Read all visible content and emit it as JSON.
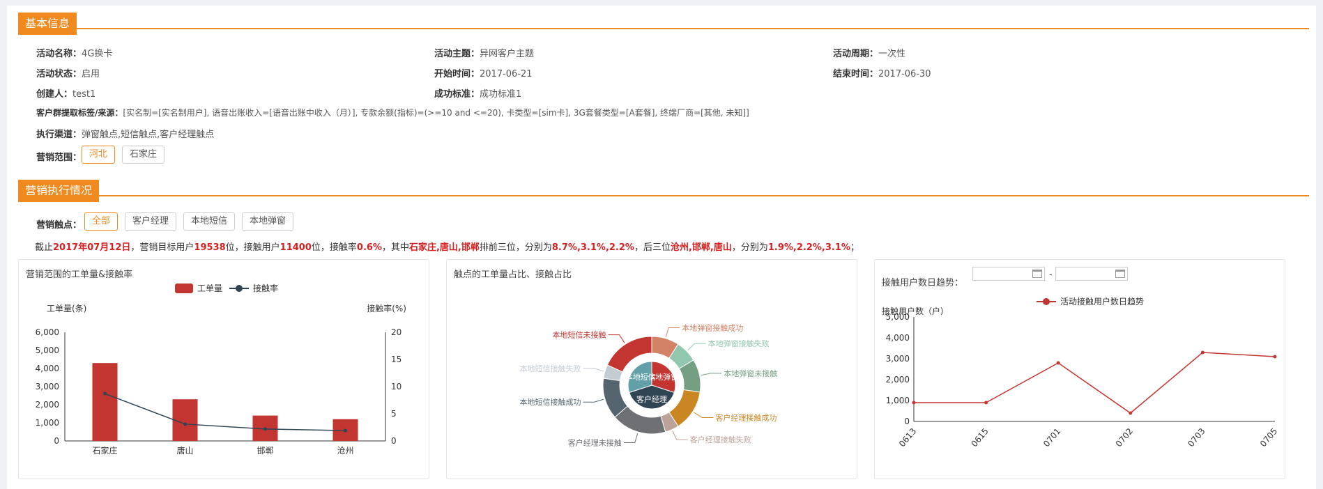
{
  "basic": {
    "title": "基本信息",
    "rows": [
      {
        "label": "活动名称：",
        "value": "4G换卡"
      },
      {
        "label": "活动主题：",
        "value": "异网客户主题"
      },
      {
        "label": "活动周期：",
        "value": "一次性"
      },
      {
        "label": "活动状态：",
        "value": "启用"
      },
      {
        "label": "开始时间：",
        "value": "2017-06-21"
      },
      {
        "label": "结束时间：",
        "value": "2017-06-30"
      },
      {
        "label": "创建人：",
        "value": "test1"
      },
      {
        "label": "成功标准：",
        "value": "成功标准1"
      },
      {
        "label": "客户群提取标签/来源：",
        "value": "[实名制=[实名制用户], 语音出账收入=[语音出账中收入（月）], 专款余额(指标)=(>=10 and <=20), 卡类型=[sim卡], 3G套餐类型=[A套餐], 终端厂商=[其他, 未知]]"
      },
      {
        "label": "执行渠道：",
        "value": "弹窗触点,短信触点,客户经理触点"
      }
    ],
    "scope_label": "营销范围：",
    "scope_chips": [
      "河北",
      "石家庄"
    ]
  },
  "execution": {
    "title": "营销执行情况",
    "touch_label": "营销触点：",
    "touch_chips": [
      "全部",
      "客户经理",
      "本地短信",
      "本地弹窗"
    ],
    "summary": [
      "截止",
      "2017年07月12日",
      "，营销目标用户",
      "19538",
      "位，接触用户",
      "11400",
      "位，接触率",
      "0.6%",
      "，其中",
      "石家庄,唐山,邯郸",
      "排前三位，分别为",
      "8.7%,3.1%,2.2%",
      "，后三位",
      "沧州,邯郸,唐山",
      "，分别为",
      "1.9%,2.2%,3.1%",
      "；"
    ]
  },
  "panel1": {
    "title": "营销范围的工单量&接触率"
  },
  "panel2": {
    "title": "触点的工单量占比、接触占比"
  },
  "panel3": {
    "title": "接触用户数日趋势：",
    "date_separator": "-"
  },
  "colors": {
    "accent": "#f08a1e",
    "bar": "#c23531",
    "line": "#2f4554",
    "highlight": "#d42020"
  },
  "chart_data": [
    {
      "type": "bar",
      "categories": [
        "石家庄",
        "唐山",
        "邯郸",
        "沧州"
      ],
      "series": [
        {
          "name": "工单量",
          "type": "bar",
          "axis": "left",
          "values": [
            4300,
            2300,
            1400,
            1200
          ]
        },
        {
          "name": "接触率",
          "type": "line",
          "axis": "right",
          "values": [
            8.7,
            3.1,
            2.2,
            1.9
          ]
        }
      ],
      "ylabel": "工单量(条)",
      "ylim": [
        0,
        6000
      ],
      "yticks": [
        "0",
        "1,000",
        "2,000",
        "3,000",
        "4,000",
        "5,000",
        "6,000"
      ],
      "y2label": "接触率(%)",
      "y2lim": [
        0,
        20
      ],
      "y2ticks": [
        "0",
        "5",
        "10",
        "15",
        "20"
      ],
      "legend": "top-center"
    },
    {
      "type": "pie",
      "inner": [
        {
          "label": "本地弹窗",
          "value": 30,
          "color": "#c23531"
        },
        {
          "label": "客户经理",
          "value": 40,
          "color": "#2f4554"
        },
        {
          "label": "本地短信",
          "value": 30,
          "color": "#61a0a8"
        }
      ],
      "outer": [
        {
          "label": "本地弹窗接触成功",
          "value": 10,
          "color": "#d48265"
        },
        {
          "label": "本地弹窗接触失败",
          "value": 8,
          "color": "#91c7ae"
        },
        {
          "label": "本地弹窗未接触",
          "value": 12,
          "color": "#749f83"
        },
        {
          "label": "客户经理接触成功",
          "value": 15,
          "color": "#ca8622"
        },
        {
          "label": "客户经理接触失败",
          "value": 5,
          "color": "#bda29a"
        },
        {
          "label": "客户经理未接触",
          "value": 20,
          "color": "#6e7074"
        },
        {
          "label": "本地短信接触成功",
          "value": 15,
          "color": "#546570"
        },
        {
          "label": "本地短信接触失败",
          "value": 5,
          "color": "#c4ccd3"
        },
        {
          "label": "本地短信未接触",
          "value": 20,
          "color": "#c23531"
        }
      ]
    },
    {
      "type": "line",
      "categories": [
        "0613",
        "0615",
        "0701",
        "0702",
        "0703",
        "0705"
      ],
      "series": [
        {
          "name": "活动接触用户数日趋势",
          "values": [
            900,
            900,
            2800,
            400,
            3300,
            3100
          ]
        }
      ],
      "ylabel": "接触用户数（户）",
      "ylim": [
        0,
        5000
      ],
      "yticks": [
        "0",
        "1,000",
        "2,000",
        "3,000",
        "4,000",
        "5,000"
      ],
      "legend": "top-center"
    }
  ]
}
